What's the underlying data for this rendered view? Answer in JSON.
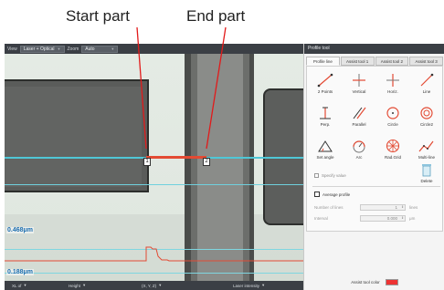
{
  "callouts": {
    "start_label": "Start part",
    "end_label": "End part"
  },
  "toolbar": {
    "view_label": "View",
    "view_value": "Laser + Optical",
    "zoom_label": "Zoom",
    "zoom_value": "Auto"
  },
  "view": {
    "marker_start": "1",
    "marker_end": "2",
    "measure_top": "0.468μm",
    "measure_bottom": "0.188μm",
    "profile_color": "#e34a33",
    "scan_line_color": "#4fc7d6"
  },
  "statusbar": {
    "cells": [
      {
        "label": "XL of",
        "dd": "▾"
      },
      {
        "label": "Height",
        "dd": "▾"
      },
      {
        "label": "(X, Y, Z)",
        "dd": "▾"
      },
      {
        "label": "Laser intensity",
        "dd": "▾"
      }
    ]
  },
  "panel": {
    "title": "Profile tool",
    "tabs": [
      "Profile line",
      "Assist tool 1",
      "Assist tool 2",
      "Assist tool 3"
    ],
    "tools": [
      {
        "label": "2 Points",
        "icon": "two-points-line-icon"
      },
      {
        "label": "Vertical",
        "icon": "vertical-cross-icon"
      },
      {
        "label": "Horiz.",
        "icon": "horizontal-cross-icon"
      },
      {
        "label": "Line",
        "icon": "line-icon"
      },
      {
        "label": "Perp.",
        "icon": "perpendicular-icon"
      },
      {
        "label": "Parallel",
        "icon": "parallel-icon"
      },
      {
        "label": "Circle",
        "icon": "circle-icon"
      },
      {
        "label": "Circle2",
        "icon": "concentric-circle-icon"
      },
      {
        "label": "Set angle",
        "icon": "set-angle-icon"
      },
      {
        "label": "Arc",
        "icon": "arc-icon"
      },
      {
        "label": "Rad.Grid",
        "icon": "radial-grid-icon"
      },
      {
        "label": "Multi-line",
        "icon": "multi-line-icon"
      }
    ],
    "delete_label": "Delete",
    "specify_value_label": "Specify value",
    "average_profile_label": "Average profile",
    "num_lines_label": "Number of lines",
    "num_lines_value": "1",
    "num_lines_unit": "lines",
    "interval_label": "Interval",
    "interval_value": "0.000",
    "interval_unit": "μm",
    "assist_color_label": "Assist tool color",
    "assist_color": "#ee3333"
  }
}
